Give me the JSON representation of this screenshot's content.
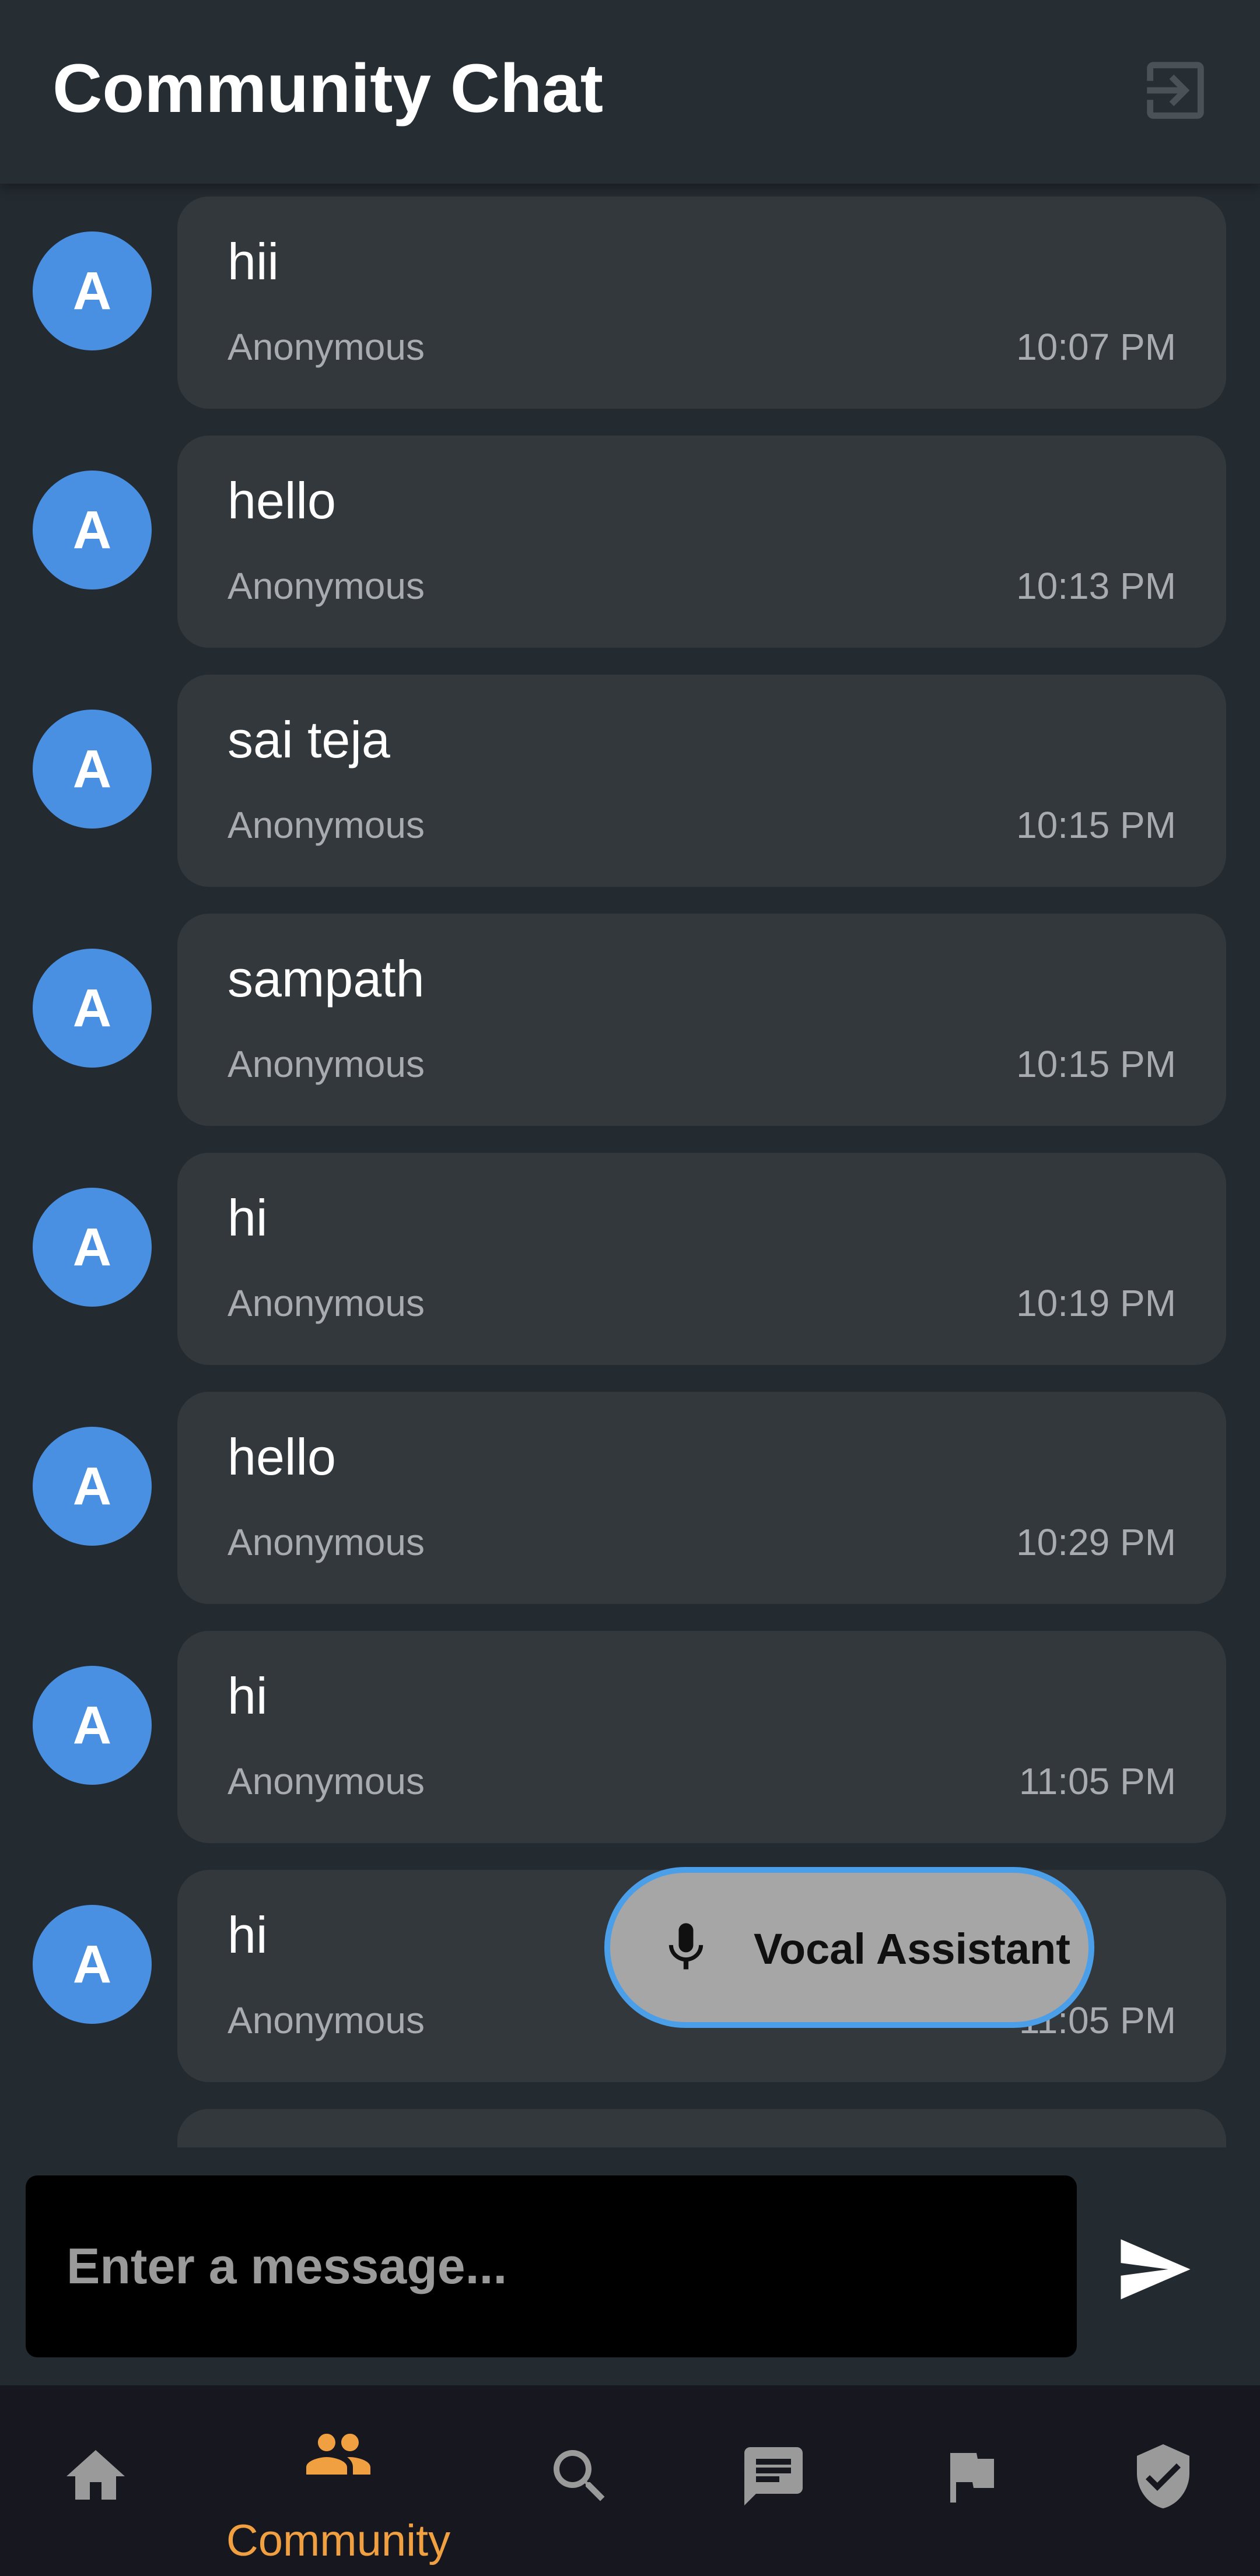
{
  "app_bar": {
    "title": "Community Chat",
    "logout_icon": "logout-icon"
  },
  "messages": [
    {
      "avatar": "A",
      "text": "hii",
      "author": "Anonymous",
      "time": "10:07 PM"
    },
    {
      "avatar": "A",
      "text": "hello",
      "author": "Anonymous",
      "time": "10:13 PM"
    },
    {
      "avatar": "A",
      "text": "sai teja",
      "author": "Anonymous",
      "time": "10:15 PM"
    },
    {
      "avatar": "A",
      "text": "sampath",
      "author": "Anonymous",
      "time": "10:15 PM"
    },
    {
      "avatar": "A",
      "text": "hi",
      "author": "Anonymous",
      "time": "10:19 PM"
    },
    {
      "avatar": "A",
      "text": "hello",
      "author": "Anonymous",
      "time": "10:29 PM"
    },
    {
      "avatar": "A",
      "text": "hi",
      "author": "Anonymous",
      "time": "11:05 PM"
    },
    {
      "avatar": "A",
      "text": "hi",
      "author": "Anonymous",
      "time": "11:05 PM"
    }
  ],
  "vocal_assistant": {
    "label": "Vocal Assistant",
    "icon": "mic-icon"
  },
  "composer": {
    "placeholder": "Enter a message...",
    "value": "",
    "send_icon": "send-icon"
  },
  "bottom_nav": {
    "active": "community",
    "items": [
      {
        "id": "home",
        "icon": "home-icon",
        "label": ""
      },
      {
        "id": "community",
        "icon": "people-icon",
        "label": "Community"
      },
      {
        "id": "search",
        "icon": "search-icon",
        "label": ""
      },
      {
        "id": "messages",
        "icon": "chat-icon",
        "label": ""
      },
      {
        "id": "report",
        "icon": "flag-icon",
        "label": ""
      },
      {
        "id": "safety",
        "icon": "shield-check-icon",
        "label": ""
      }
    ]
  },
  "colors": {
    "background": "#232a30",
    "app_bar": "#262e34",
    "bubble": "#33383c",
    "avatar": "#4a90e2",
    "active_nav": "#f0a040",
    "inactive_nav": "#9a9a9a",
    "nav_background": "#17171f"
  }
}
